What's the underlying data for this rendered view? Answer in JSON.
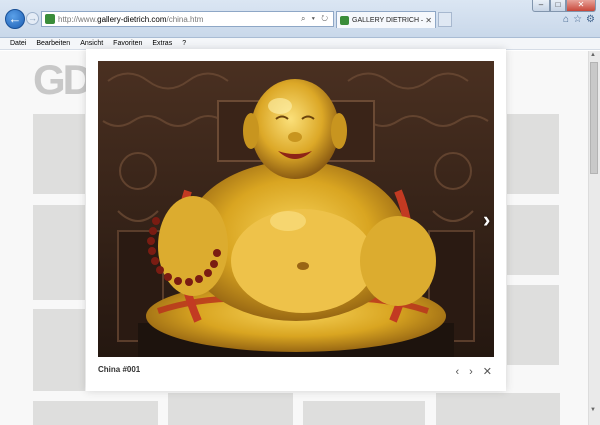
{
  "browser": {
    "url_prefix": "http://www.",
    "url_domain": "gallery-dietrich.com",
    "url_path": "/china.htm",
    "tab_title": "GALLERY DIETRICH — REIS...",
    "addr_tools": "⌕ ▾ ↻"
  },
  "menu": [
    "Datei",
    "Bearbeiten",
    "Ansicht",
    "Favoriten",
    "Extras",
    "?"
  ],
  "page": {
    "logo_text": "GD"
  },
  "lightbox": {
    "caption": "China #001"
  },
  "colors": {
    "gold": "#d9a521",
    "wood": "#3b261a",
    "accent": "#1d5fb4"
  }
}
